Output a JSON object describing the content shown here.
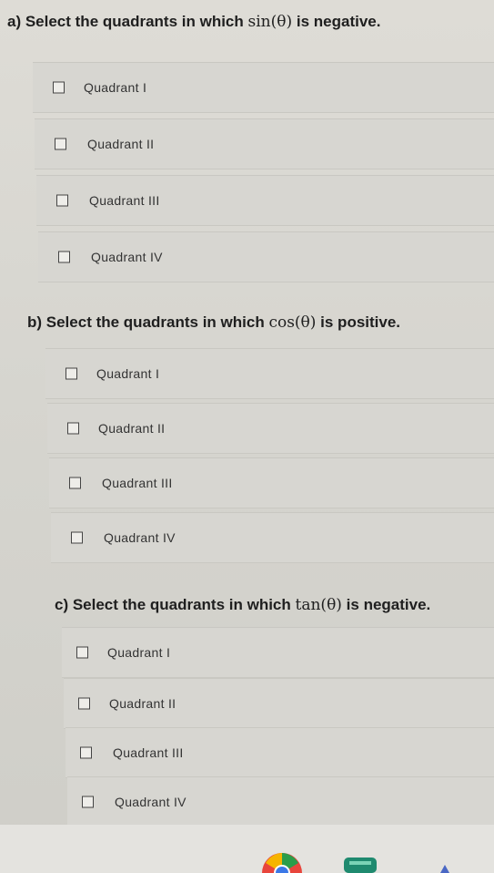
{
  "questions": [
    {
      "title_prefix": "a) Select the quadrants in which",
      "title_math": "sin(θ)",
      "title_suffix": "is negative.",
      "options": [
        "Quadrant I",
        "Quadrant II",
        "Quadrant III",
        "Quadrant IV"
      ]
    },
    {
      "title_prefix": "b) Select the quadrants in which",
      "title_math": "cos(θ)",
      "title_suffix": "is positive.",
      "options": [
        "Quadrant I",
        "Quadrant II",
        "Quadrant III",
        "Quadrant IV"
      ]
    },
    {
      "title_prefix": "c) Select the quadrants in which",
      "title_math": "tan(θ)",
      "title_suffix": "is negative.",
      "options": [
        "Quadrant I",
        "Quadrant II",
        "Quadrant III",
        "Quadrant IV"
      ]
    }
  ],
  "colors": {
    "background": "#d9d8d3",
    "option_background": "#d7d6d1",
    "text": "#1f1f1f"
  }
}
